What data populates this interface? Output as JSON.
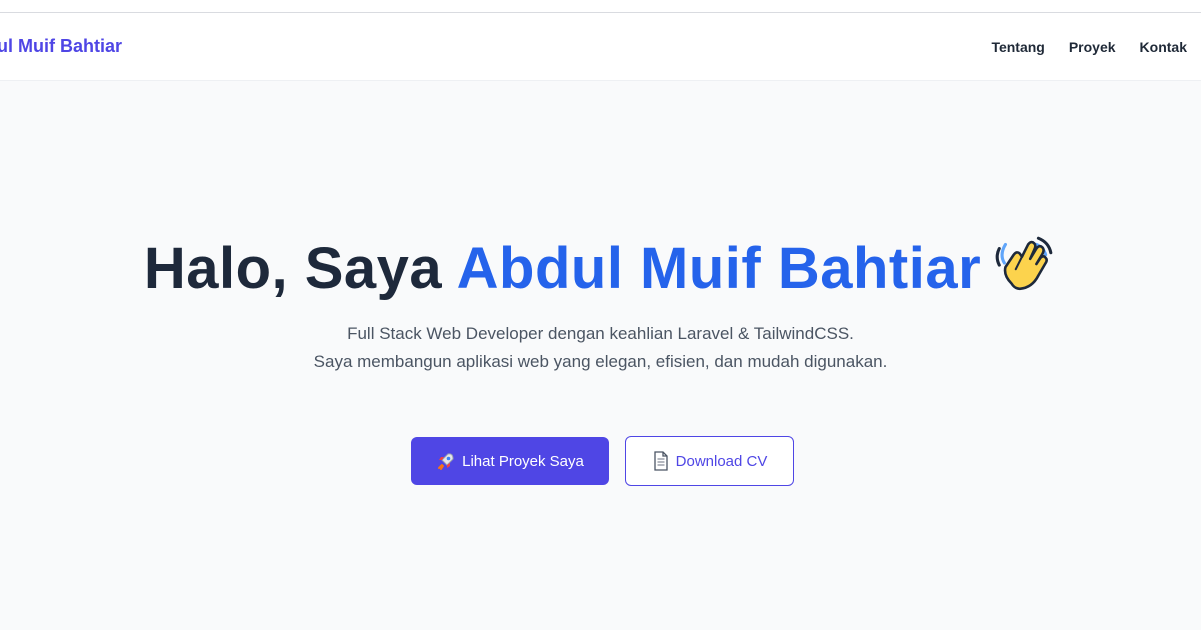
{
  "nav": {
    "brand": "dul Muif Bahtiar",
    "links": [
      "Tentang",
      "Proyek",
      "Kontak"
    ]
  },
  "hero": {
    "greeting": "Halo, Saya ",
    "name": "Abdul Muif Bahtiar",
    "emoji_icon": "waving-hand-icon",
    "subtitle_line1": "Full Stack Web Developer dengan keahlian Laravel & TailwindCSS.",
    "subtitle_line2": "Saya membangun aplikasi web yang elegan, efisien, dan mudah digunakan."
  },
  "buttons": {
    "primary_label": "Lihat Proyek Saya",
    "primary_icon": "rocket-icon",
    "secondary_label": "Download CV",
    "secondary_icon": "document-icon"
  },
  "colors": {
    "brand": "#4f46e5",
    "accent": "#2563eb",
    "heading": "#1e293b",
    "background": "#f9fafb"
  }
}
